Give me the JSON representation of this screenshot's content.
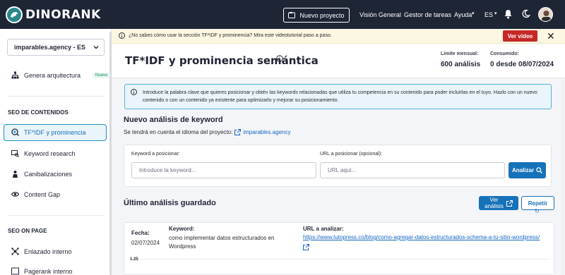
{
  "app": {
    "logo_text": "DINORANK"
  },
  "topnav": {
    "new_project_label": "Nuevo proyecto",
    "links": [
      "Visión General",
      "Gestor de tareas",
      "Ayuda"
    ],
    "language": "ES"
  },
  "banner": {
    "text": "¿No sabes cómo usar la sección TF*IDF y prominencia? Mira este videotutorial paso a paso.",
    "button_label": "Ver vídeo",
    "close_glyph": "✕"
  },
  "sidebar": {
    "project": "imparables.agency - ES",
    "top_item": {
      "label": "Genera arquitectura",
      "badge": "Nuevo"
    },
    "sections": [
      {
        "title": "SEO DE CONTENIDOS",
        "items": [
          "TF*IDF y prominencia",
          "Keyword research",
          "Canibalizaciones",
          "Content Gap"
        ]
      },
      {
        "title": "SEO ON PAGE",
        "items": [
          "Enlazado interno",
          "Pagerank interno"
        ]
      }
    ]
  },
  "header": {
    "title": "TF*IDF y prominencia semántica",
    "limit_label": "Límite mensual:",
    "limit_value": "600 análisis",
    "usage_label": "Consumido:",
    "usage_value": "0 desde 08/07/2024"
  },
  "alert": {
    "text": "Introduce la palabra clave que quieres posicionar y obtén las keywords relacionadas que utiliza tu competencia en su contenido para poder incluirlas en el tuyo. Hazlo con un nuevo contenido o con un contenido ya existente para optimizarlo y mejorar su posicionamiento."
  },
  "new_analysis": {
    "heading": "Nuevo análisis de keyword",
    "lang_note": "Se tendrá en cuenta el idioma del proyecto:",
    "lang_link": "imparables.agency",
    "keyword_label": "Keyword a posicionar:",
    "keyword_placeholder": "Introduce la keyword...",
    "url_label": "URL a posicionar (opcional):",
    "url_placeholder": "URL aquí...",
    "analyze_label": "Analizar"
  },
  "last_analysis": {
    "heading": "Último análisis guardado",
    "view_label_1": "Ver",
    "view_label_2": "análisis",
    "repeat_label": "Repetir",
    "date_label": "Fecha:",
    "date_value": "02/07/2024",
    "keyword_label": "Keyword:",
    "keyword_value_1": "como implementar datos estructurados en",
    "keyword_value_2": "Wordpress",
    "url_label": "URL a analizar:",
    "url_value": "https://www.tutopress.co/blog/como-agregar-datos-estructurados-schema-a-tu-sitio-wordpress/",
    "chart_tick": "1.25"
  },
  "colors": {
    "topnav_bg": "#1e2535",
    "accent": "#1672b8",
    "alert_border": "#4fb3d9",
    "danger": "#c62828",
    "badge_green": "#1b8c5b"
  }
}
